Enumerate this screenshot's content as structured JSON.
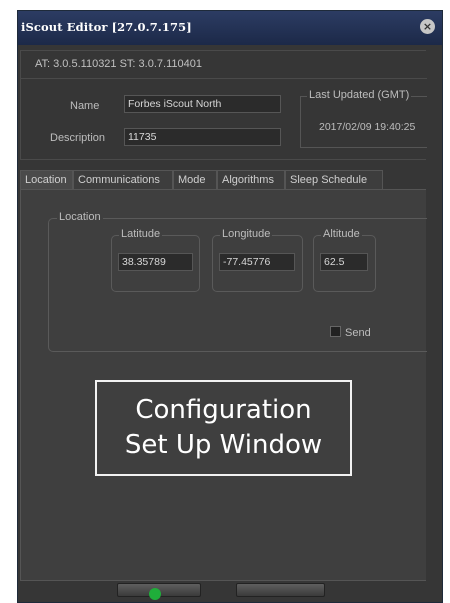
{
  "window": {
    "title": "iScout Editor [27.0.7.175]",
    "close_icon": "close-icon"
  },
  "header": {
    "versions": "AT: 3.0.5.110321  ST: 3.0.7.110401",
    "name_label": "Name",
    "name_value": "Forbes iScout North",
    "description_label": "Description",
    "description_value": "11735",
    "last_updated_label": "Last Updated (GMT)",
    "last_updated_value": "2017/02/09 19:40:25"
  },
  "tabs": [
    {
      "label": "Location",
      "active": true
    },
    {
      "label": "Communications",
      "active": false
    },
    {
      "label": "Mode",
      "active": false
    },
    {
      "label": "Algorithms",
      "active": false
    },
    {
      "label": "Sleep Schedule",
      "active": false
    }
  ],
  "location": {
    "group_label": "Location",
    "latitude_label": "Latitude",
    "latitude_value": "38.35789",
    "longitude_label": "Longitude",
    "longitude_value": "-77.45776",
    "altitude_label": "Altitude",
    "altitude_value": "62.5",
    "send_label": "Send",
    "send_checked": false
  },
  "overlay": {
    "line1": "Configuration",
    "line2": "Set Up Window"
  },
  "colors": {
    "window_bg": "#363636",
    "titlebar": "#2c3c63",
    "ok_indicator": "#1fae3a"
  }
}
